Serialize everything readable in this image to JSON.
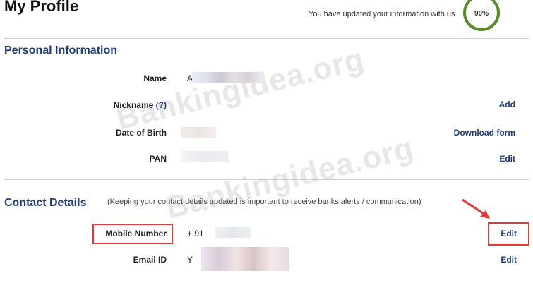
{
  "header": {
    "title": "My Profile",
    "progress_text": "You have updated your information with us",
    "progress_percent": "90%",
    "progress_fraction": 0.9
  },
  "personal": {
    "title": "Personal Information",
    "rows": {
      "name": {
        "label": "Name",
        "value": "A"
      },
      "nickname": {
        "label": "Nickname",
        "tip": "(?)",
        "action": "Add"
      },
      "dob": {
        "label": "Date of Birth",
        "action": "Download form"
      },
      "pan": {
        "label": "PAN",
        "action": "Edit"
      }
    }
  },
  "contact": {
    "title": "Contact Details",
    "note": "(Keeping your contact details updated is important to receive banks alerts / communication)",
    "rows": {
      "mobile": {
        "label": "Mobile Number",
        "value": "+ 91",
        "action": "Edit"
      },
      "email": {
        "label": "Email ID",
        "value": "Y",
        "action": "Edit"
      }
    }
  },
  "watermark": "Bankingidea.org",
  "colors": {
    "accent": "#1f3d73",
    "highlight": "#e23a3a",
    "gauge": "#5a8a2a"
  }
}
